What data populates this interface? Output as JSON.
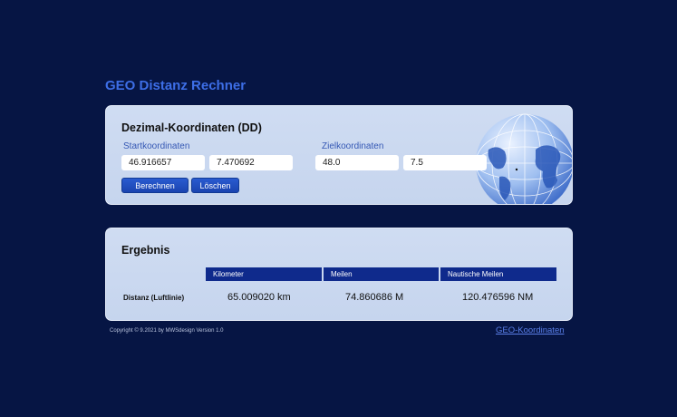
{
  "page": {
    "title": "GEO Distanz Rechner"
  },
  "input_panel": {
    "heading": "Dezimal-Koordinaten (DD)",
    "start_label": "Startkoordinaten",
    "target_label": "Zielkoordinaten",
    "start_lat": "46.916657",
    "start_lon": "7.470692",
    "target_lat": "48.0",
    "target_lon": "7.5",
    "calc_button": "Berechnen",
    "clear_button": "Löschen"
  },
  "result_panel": {
    "heading": "Ergebnis",
    "columns": [
      "Kilometer",
      "Meilen",
      "Nautische Meilen"
    ],
    "row_label": "Distanz (Luftlinie)",
    "values": [
      "65.009020 km",
      "74.860686 M",
      "120.476596 NM"
    ]
  },
  "footer": {
    "copyright": "Copyright ©  9.2021 by MWSdesign   Version 1.0",
    "link": "GEO-Koordinaten"
  },
  "colors": {
    "background": "#061544",
    "accent": "#3d6ee6",
    "header": "#0f2a8c"
  }
}
